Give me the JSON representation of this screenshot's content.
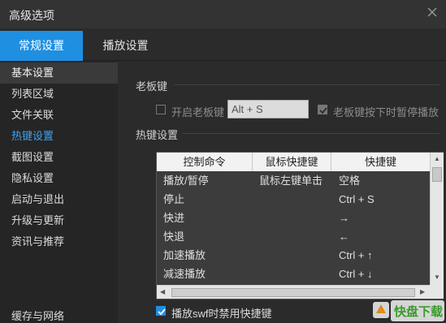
{
  "window": {
    "title": "高级选项"
  },
  "tabs": [
    {
      "label": "常规设置",
      "active": true
    },
    {
      "label": "播放设置",
      "active": false
    }
  ],
  "sidebar": {
    "items": [
      {
        "label": "基本设置"
      },
      {
        "label": "列表区域"
      },
      {
        "label": "文件关联"
      },
      {
        "label": "热键设置"
      },
      {
        "label": "截图设置"
      },
      {
        "label": "隐私设置"
      },
      {
        "label": "启动与退出"
      },
      {
        "label": "升级与更新"
      },
      {
        "label": "资讯与推荐"
      },
      {
        "label": "缓存与网络"
      }
    ]
  },
  "boss_key": {
    "section_title": "老板键",
    "enable_label": "开启老板键",
    "enable_checked": false,
    "hotkey_value": "Alt + S",
    "pause_label": "老板键按下时暂停播放",
    "pause_checked": true
  },
  "hotkeys": {
    "section_title": "热键设置",
    "columns": [
      "控制命令",
      "鼠标快捷键",
      "快捷键"
    ],
    "rows": [
      {
        "command": "播放/暂停",
        "mouse": "鼠标左键单击",
        "key": "空格"
      },
      {
        "command": "停止",
        "mouse": "",
        "key": "Ctrl + S"
      },
      {
        "command": "快进",
        "mouse": "",
        "key": "→"
      },
      {
        "command": "快退",
        "mouse": "",
        "key": "←"
      },
      {
        "command": "加速播放",
        "mouse": "",
        "key": "Ctrl + ↑"
      },
      {
        "command": "减速播放",
        "mouse": "",
        "key": "Ctrl + ↓"
      }
    ],
    "disable_swf_label": "播放swf时禁用快捷键",
    "disable_swf_checked": true
  },
  "watermark": {
    "text": "快盘下载"
  },
  "colors": {
    "accent": "#1e8fe1",
    "highlight_text": "#3fa3f0",
    "background": "#2b2b2b",
    "sidebar_bg": "#252525"
  },
  "icons": {
    "close": "close-icon",
    "check": "check-icon"
  }
}
